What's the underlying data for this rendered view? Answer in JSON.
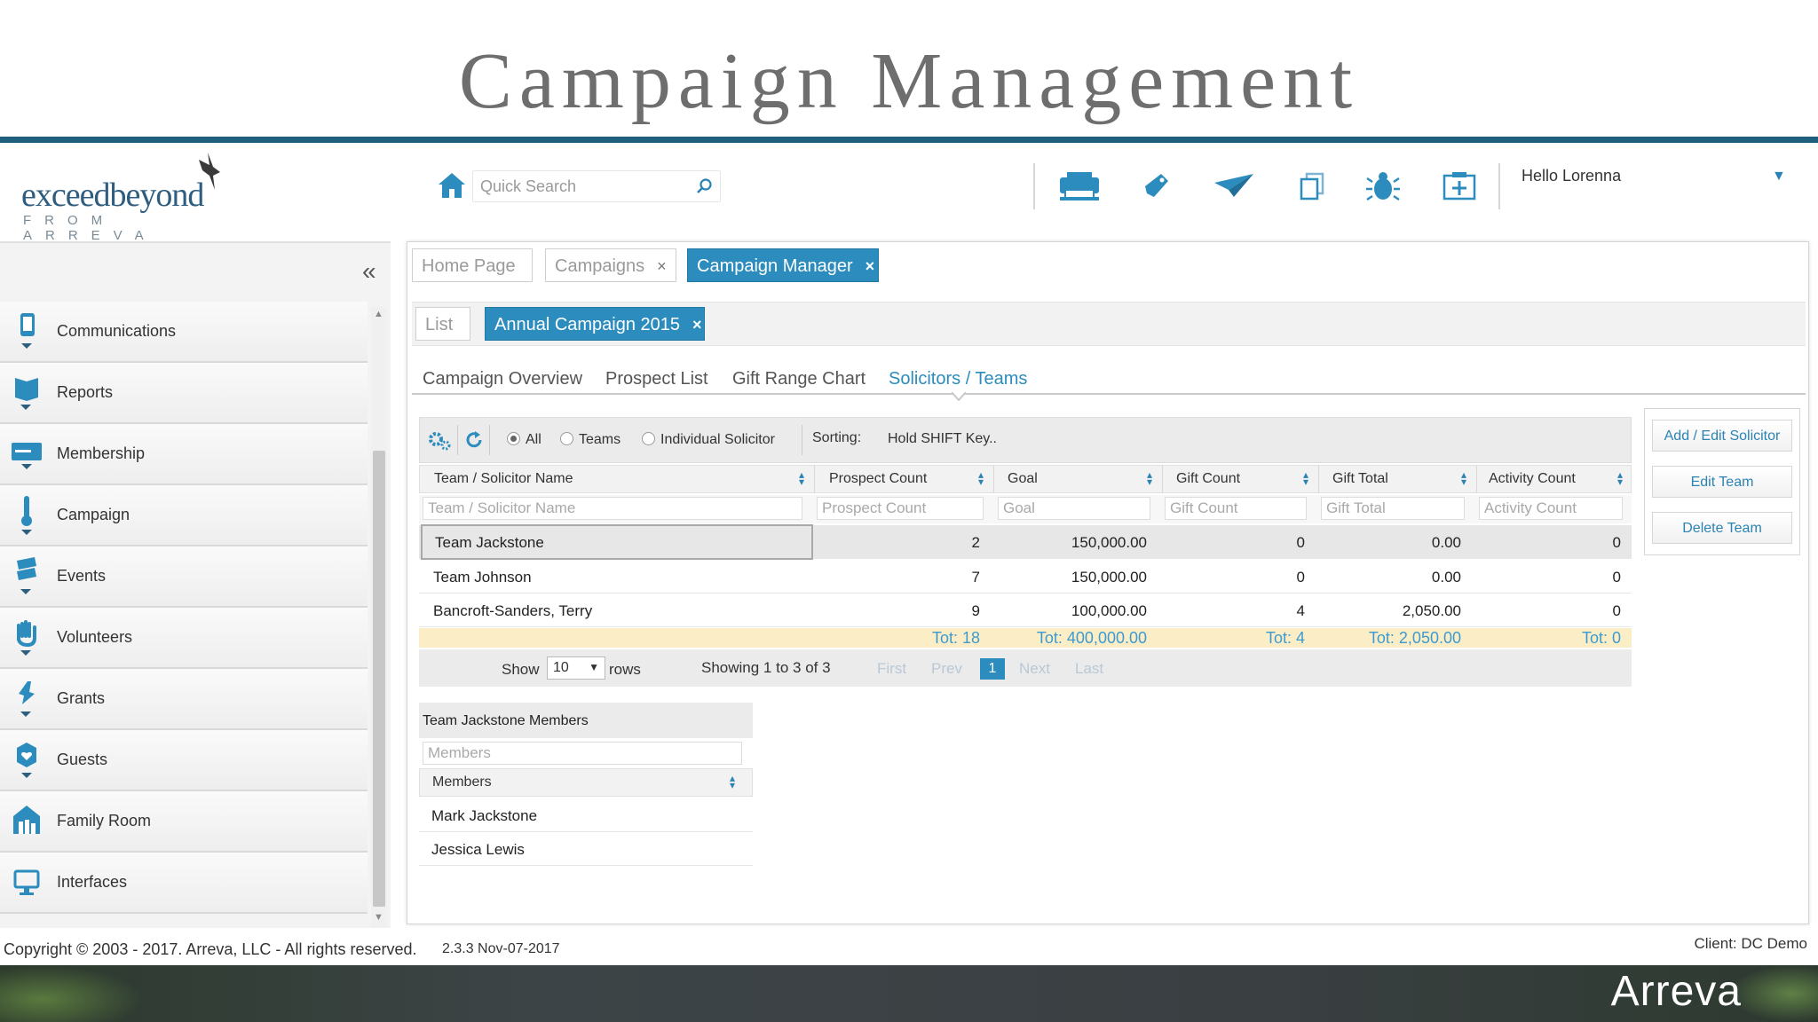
{
  "slide": {
    "title": "Campaign Management"
  },
  "app": {
    "logo": {
      "brand": "exceedbeyond",
      "sub": "FROM ARREVA"
    },
    "search": {
      "placeholder": "Quick Search"
    },
    "user": {
      "greeting": "Hello Lorenna"
    },
    "toolbar_icons": [
      "print-icon",
      "tag-icon",
      "send-icon",
      "copy-icon",
      "bug-icon",
      "add-panel-icon"
    ]
  },
  "sidebar": {
    "items": [
      {
        "label": "Communications",
        "icon": "phone-icon"
      },
      {
        "label": "Reports",
        "icon": "book-icon"
      },
      {
        "label": "Membership",
        "icon": "card-icon"
      },
      {
        "label": "Campaign",
        "icon": "thermometer-icon"
      },
      {
        "label": "Events",
        "icon": "calendar-icon"
      },
      {
        "label": "Volunteers",
        "icon": "hand-icon"
      },
      {
        "label": "Grants",
        "icon": "grants-icon"
      },
      {
        "label": "Guests",
        "icon": "heart-icon"
      },
      {
        "label": "Family Room",
        "icon": "family-icon"
      },
      {
        "label": "Interfaces",
        "icon": "monitor-icon"
      }
    ]
  },
  "tabs": {
    "top": [
      {
        "label": "Home Page"
      },
      {
        "label": "Campaigns"
      },
      {
        "label": "Campaign Manager"
      }
    ],
    "second": [
      {
        "label": "List"
      },
      {
        "label": "Annual Campaign 2015"
      }
    ],
    "close": "×"
  },
  "subnav": [
    "Campaign Overview",
    "Prospect List",
    "Gift Range Chart",
    "Solicitors / Teams"
  ],
  "grid": {
    "filters": {
      "all": "All",
      "teams": "Teams",
      "individual": "Individual Solicitor"
    },
    "sorting_label": "Sorting:",
    "sorting_hint": "Hold SHIFT Key..",
    "columns": [
      "Team / Solicitor Name",
      "Prospect Count",
      "Goal",
      "Gift Count",
      "Gift Total",
      "Activity Count"
    ],
    "rows": [
      {
        "name": "Team Jackstone",
        "prospect_count": "2",
        "goal": "150,000.00",
        "gift_count": "0",
        "gift_total": "0.00",
        "activity_count": "0"
      },
      {
        "name": "Team Johnson",
        "prospect_count": "7",
        "goal": "150,000.00",
        "gift_count": "0",
        "gift_total": "0.00",
        "activity_count": "0"
      },
      {
        "name": "Bancroft-Sanders, Terry",
        "prospect_count": "9",
        "goal": "100,000.00",
        "gift_count": "4",
        "gift_total": "2,050.00",
        "activity_count": "0"
      }
    ],
    "totals": {
      "prospect_count": "Tot: 18",
      "goal": "Tot: 400,000.00",
      "gift_count": "Tot: 4",
      "gift_total": "Tot: 2,050.00",
      "activity_count": "Tot: 0"
    },
    "pager": {
      "show": "Show",
      "rows_value": "10",
      "rows": "rows",
      "showing": "Showing 1 to 3 of 3",
      "first": "First",
      "prev": "Prev",
      "page": "1",
      "next": "Next",
      "last": "Last"
    }
  },
  "actions": {
    "add_edit": "Add / Edit Solicitor",
    "edit_team": "Edit Team",
    "delete_team": "Delete Team"
  },
  "members": {
    "title": "Team Jackstone  Members",
    "placeholder": "Members",
    "column": "Members",
    "rows": [
      "Mark Jackstone",
      "Jessica Lewis"
    ]
  },
  "footer": {
    "copyright": "Copyright © 2003 - 2017. Arreva, LLC - All rights reserved.",
    "version": "2.3.3 Nov-07-2017",
    "client_label": "Client:",
    "client_value": "DC Demo",
    "brand": "Arreva"
  },
  "colors": {
    "accent": "#2b8cbd",
    "title_rule": "#1f5f7e",
    "totals_bg": "#fbeec7"
  }
}
